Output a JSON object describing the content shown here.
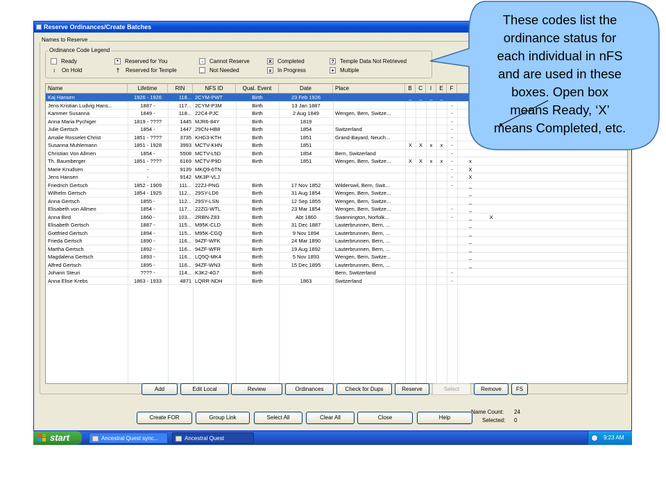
{
  "window": {
    "title": "Reserve Ordinances/Create Batches"
  },
  "groups": {
    "names_to_reserve": "Names to Reserve",
    "legend": "Ordinance Code Legend"
  },
  "legend": [
    {
      "symbol": "",
      "label": "Ready"
    },
    {
      "symbol": "*",
      "label": "Reserved for You"
    },
    {
      "symbol": "-",
      "label": "Cannot Reserve"
    },
    {
      "symbol": "X",
      "label": "Completed"
    },
    {
      "symbol": "?",
      "label": "Temple Data Not Retrieved"
    },
    {
      "symbol": "↕",
      "label": "On Hold"
    },
    {
      "symbol": "†",
      "label": "Reserved for Temple"
    },
    {
      "symbol": "_",
      "label": "Not Needed"
    },
    {
      "symbol": "x",
      "label": "In Progress"
    },
    {
      "symbol": "+",
      "label": "Multiple"
    }
  ],
  "table": {
    "columns": [
      "Name",
      "Lifetime",
      "RIN",
      "NFS ID",
      "Qual. Event",
      "Date",
      "Place",
      "B",
      "C",
      "I",
      "E",
      "F"
    ],
    "rows": [
      {
        "name": "Kaj Hansen",
        "lifetime": "1926 - 1926",
        "rin": "118...",
        "nfsid": "2CYM-PWT",
        "event": "Birth",
        "date": "23 Feb 1926",
        "place": "",
        "b": "_",
        "c": "_",
        "i": "_",
        "e": "_",
        "f": "",
        "selected": true
      },
      {
        "name": "Jens Kristian Ludvig Hans...",
        "lifetime": "1887 -",
        "rin": "117...",
        "nfsid": "2CYM-P3M",
        "event": "Birth",
        "date": "13 Jan 1887",
        "place": "",
        "b": "",
        "c": "",
        "i": "",
        "e": "",
        "f": "-"
      },
      {
        "name": "Kammer Susanna",
        "lifetime": "1849 -",
        "rin": "118...",
        "nfsid": "22C4-PJC",
        "event": "Birth",
        "date": "2 Aug 1849",
        "place": "Wengen, Bern, Switze...",
        "b": "",
        "c": "",
        "i": "",
        "e": "",
        "f": "-"
      },
      {
        "name": "Anna Maria Pychiger",
        "lifetime": "1819 - ????",
        "rin": "1445",
        "nfsid": "MJR6-84Y",
        "event": "Birth",
        "date": "1819",
        "place": "",
        "b": "",
        "c": "",
        "i": "",
        "e": "",
        "f": "-"
      },
      {
        "name": "Julie Gertsch",
        "lifetime": "1854 -",
        "rin": "1447",
        "nfsid": "29CN-HB8",
        "event": "Birth",
        "date": "1854",
        "place": "Switzerland",
        "b": "",
        "c": "",
        "i": "",
        "e": "",
        "f": "-"
      },
      {
        "name": "Amalie Rosselet-Christ",
        "lifetime": "1851 - ????",
        "rin": "3735",
        "nfsid": "KHG3-KTH",
        "event": "Birth",
        "date": "1851",
        "place": "Grand-Bayard, Neuch...",
        "b": "",
        "c": "",
        "i": "",
        "e": "",
        "f": "-"
      },
      {
        "name": "Susanna Muhlemann",
        "lifetime": "1851 - 1928",
        "rin": "3993",
        "nfsid": "MCTV-KHN",
        "event": "Birth",
        "date": "1851",
        "place": "",
        "b": "X",
        "c": "X",
        "i": "x",
        "e": "x",
        "f": "-"
      },
      {
        "name": "Christian Von Allmen",
        "lifetime": "1854 -",
        "rin": "5508",
        "nfsid": "MCTV-L5D",
        "event": "Birth",
        "date": "1854",
        "place": "Bern, Switzerland",
        "b": "",
        "c": "",
        "i": "",
        "e": "",
        "f": "-"
      },
      {
        "name": "Th. Baumberger",
        "lifetime": "1851 - ????",
        "rin": "6169",
        "nfsid": "MCTV-P9D",
        "event": "Birth",
        "date": "1851",
        "place": "Wengen, Bern, Switze...",
        "b": "X",
        "c": "X",
        "i": "x",
        "e": "x",
        "f": "-",
        "g": "x"
      },
      {
        "name": "Marie Knudsen",
        "lifetime": "-",
        "rin": "9139",
        "nfsid": "MKQ9-6TN",
        "event": "",
        "date": "",
        "place": "",
        "b": "",
        "c": "",
        "i": "",
        "e": "",
        "f": "-",
        "g": "X"
      },
      {
        "name": "Jens Hansen",
        "lifetime": "-",
        "rin": "9142",
        "nfsid": "MK3P-VLJ",
        "event": "",
        "date": "",
        "place": "",
        "b": "",
        "c": "",
        "i": "",
        "e": "",
        "f": "-",
        "g": "X"
      },
      {
        "name": "Friedrich Gertsch",
        "lifetime": "1852 - 1909",
        "rin": "111...",
        "nfsid": "22ZJ-PNG",
        "event": "Birth",
        "date": "17 Nov 1852",
        "place": "Wilderswil, Bern, Swit...",
        "b": "",
        "c": "",
        "i": "",
        "e": "",
        "f": "-",
        "g": "_"
      },
      {
        "name": "Wilhelm Gertsch",
        "lifetime": "1854 - 1925",
        "rin": "112...",
        "nfsid": "29SY-LD6",
        "event": "Birth",
        "date": "31 Aug 1854",
        "place": "Wengen, Bern, Switze...",
        "b": "",
        "c": "",
        "i": "",
        "e": "",
        "f": "",
        "g": "_"
      },
      {
        "name": "Anna Gertsch",
        "lifetime": "1855 -",
        "rin": "112...",
        "nfsid": "29SY-LSN",
        "event": "Birth",
        "date": "12 Sep 1855",
        "place": "Wengen, Bern, Switze...",
        "b": "",
        "c": "",
        "i": "",
        "e": "",
        "f": "",
        "g": "_"
      },
      {
        "name": "Elisabeth von Allmen",
        "lifetime": "1854 -",
        "rin": "117...",
        "nfsid": "22ZG-WTL",
        "event": "Birth",
        "date": "23 Mar 1854",
        "place": "Wengen, Bern, Switze...",
        "b": "",
        "c": "",
        "i": "",
        "e": "",
        "f": "-",
        "g": "_"
      },
      {
        "name": "Anna Bird",
        "lifetime": "1860 -",
        "rin": "103...",
        "nfsid": "2RBN-Z83",
        "event": "Birth",
        "date": "Abt 1860",
        "place": "Swannington, Norfolk...",
        "b": "",
        "c": "",
        "i": "",
        "e": "",
        "f": "-",
        "g": "_",
        "h": "X"
      },
      {
        "name": "Elisabeth Gertsch",
        "lifetime": "1887 -",
        "rin": "115...",
        "nfsid": "M95K-CLD",
        "event": "Birth",
        "date": "31 Dec 1887",
        "place": "Lauterbrunnen, Bern, ...",
        "b": "",
        "c": "",
        "i": "",
        "e": "",
        "f": "",
        "g": "_"
      },
      {
        "name": "Gottfried Gertsch",
        "lifetime": "1894 -",
        "rin": "115...",
        "nfsid": "M95K-CGQ",
        "event": "Birth",
        "date": "9 Nov 1894",
        "place": "Lauterbrunnen, Bern, ...",
        "b": "",
        "c": "",
        "i": "",
        "e": "",
        "f": "",
        "g": "_"
      },
      {
        "name": "Frieda Gertsch",
        "lifetime": "1890 -",
        "rin": "116...",
        "nfsid": "94ZF-WFK",
        "event": "Birth",
        "date": "24 Mar 1890",
        "place": "Lauterbrunnen, Bern, ...",
        "b": "",
        "c": "",
        "i": "",
        "e": "",
        "f": "",
        "g": "_"
      },
      {
        "name": "Martha Gertsch",
        "lifetime": "1892 -",
        "rin": "116...",
        "nfsid": "94ZF-WFR",
        "event": "Birth",
        "date": "19 Aug 1892",
        "place": "Lauterbrunnen, Bern, ...",
        "b": "",
        "c": "",
        "i": "",
        "e": "",
        "f": "",
        "g": "_"
      },
      {
        "name": "Magdalena Gertsch",
        "lifetime": "1893 -",
        "rin": "116...",
        "nfsid": "LQ5Q-MK4",
        "event": "Birth",
        "date": "5 Nov 1893",
        "place": "Wengen, Bern, Switze...",
        "b": "",
        "c": "",
        "i": "",
        "e": "",
        "f": "",
        "g": "_"
      },
      {
        "name": "Alfred Gertsch",
        "lifetime": "1895 -",
        "rin": "116...",
        "nfsid": "94ZF-WN3",
        "event": "Birth",
        "date": "15 Dec 1895",
        "place": "Lauterbrunnen, Bern, ...",
        "b": "",
        "c": "",
        "i": "",
        "e": "",
        "f": "",
        "g": "_"
      },
      {
        "name": "Johann Steuri",
        "lifetime": "???? -",
        "rin": "114...",
        "nfsid": "K3K2-4G7",
        "event": "Birth",
        "date": "",
        "place": "Bern, Switzerland",
        "b": "",
        "c": "",
        "i": "",
        "e": "",
        "f": "-"
      },
      {
        "name": "Anna Elise Krebs",
        "lifetime": "1863 - 1933",
        "rin": "4871",
        "nfsid": "LQRR-NDH",
        "event": "Birth",
        "date": "1863",
        "place": "Switzerland",
        "b": "",
        "c": "",
        "i": "",
        "e": "",
        "f": "-"
      }
    ]
  },
  "buttons_row1": [
    "Add",
    "Edit Local",
    "Review",
    "Ordinances",
    "Check for Dups",
    "Reserve",
    "Select",
    "Remove",
    "FS"
  ],
  "buttons_row2": [
    "Create FOR",
    "Group Link",
    "Select All",
    "Clear All",
    "Close",
    "Help"
  ],
  "counts": {
    "name_count_label": "Name Count:",
    "name_count": "24",
    "selected_label": "Selected:",
    "selected": "0"
  },
  "taskbar": {
    "start": "start",
    "tasks": [
      "Ancestral Quest sync...",
      "Ancestral Quest"
    ],
    "clock": "9:23 AM"
  },
  "callout": {
    "lines": [
      "These codes list the",
      "ordinance status for",
      "each individual in nFS",
      "and are used in these",
      "boxes.  Open box",
      "means Ready, ‘X’",
      "means Completed, etc."
    ]
  },
  "colors": {
    "title_bar": "#0a4fd6",
    "selection": "#316ac5",
    "callout_fill": "#99ccff",
    "callout_stroke": "#3a6ea5",
    "window_bg": "#ece9d8"
  }
}
